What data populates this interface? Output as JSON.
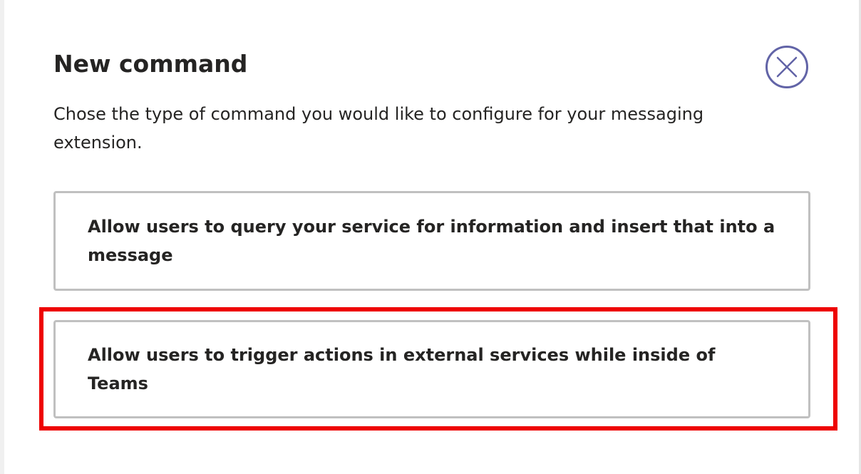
{
  "dialog": {
    "title": "New command",
    "description": "Chose the type of command you would like to configure for your messaging extension.",
    "close_icon": "close-icon",
    "accent_color": "#6264a7"
  },
  "options": [
    {
      "label": "Allow users to query your service for information and insert that into a message"
    },
    {
      "label": "Allow users to trigger actions in external services while inside of Teams"
    }
  ],
  "highlight": {
    "color": "#ee0000",
    "target": "options.1"
  }
}
